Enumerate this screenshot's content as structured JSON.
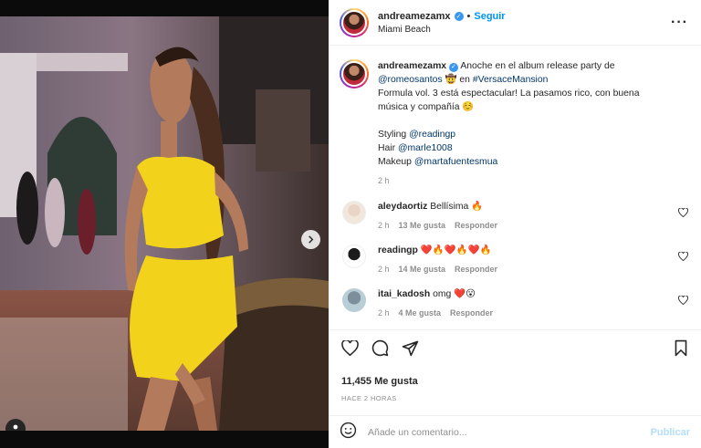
{
  "post": {
    "username": "andreamezamx",
    "follow_label": "Seguir",
    "location": "Miami Beach",
    "more_icon": "more-options-icon",
    "caption": {
      "username": "andreamezamx",
      "text_1": "Anoche en el album release party de",
      "mention_1": "@romeosantos",
      "emoji_1": "🤠",
      "word_en": "en",
      "hashtag": "#VersaceMansion",
      "text_2": "Formula vol. 3 está espectacular! La pasamos rico, con buena música y compañía",
      "emoji_2": "☺️",
      "styling_label": "Styling",
      "styling_handle": "@readingp",
      "hair_label": "Hair",
      "hair_handle": "@marle1008",
      "makeup_label": "Makeup",
      "makeup_handle": "@martafuentesmua",
      "time": "2 h"
    },
    "comments": [
      {
        "username": "aleydaortiz",
        "text": "Bellísima 🔥",
        "time": "2 h",
        "likes": "13 Me gusta",
        "reply": "Responder"
      },
      {
        "username": "readingp",
        "text": "❤️🔥❤️🔥❤️🔥",
        "time": "2 h",
        "likes": "14 Me gusta",
        "reply": "Responder"
      },
      {
        "username": "itai_kadosh",
        "text": "omg ❤️😮",
        "time": "2 h",
        "likes": "4 Me gusta",
        "reply": "Responder"
      }
    ],
    "likes_count": "11,455 Me gusta",
    "posted_ago": "HACE 2 HORAS",
    "comment_placeholder": "Añade un comentario...",
    "publish_label": "Publicar"
  },
  "colors": {
    "accent": "#0095f6",
    "publish_disabled": "#b2dffc",
    "dress": "#f2d21b"
  },
  "carousel": {
    "total": 5,
    "active": 1
  }
}
